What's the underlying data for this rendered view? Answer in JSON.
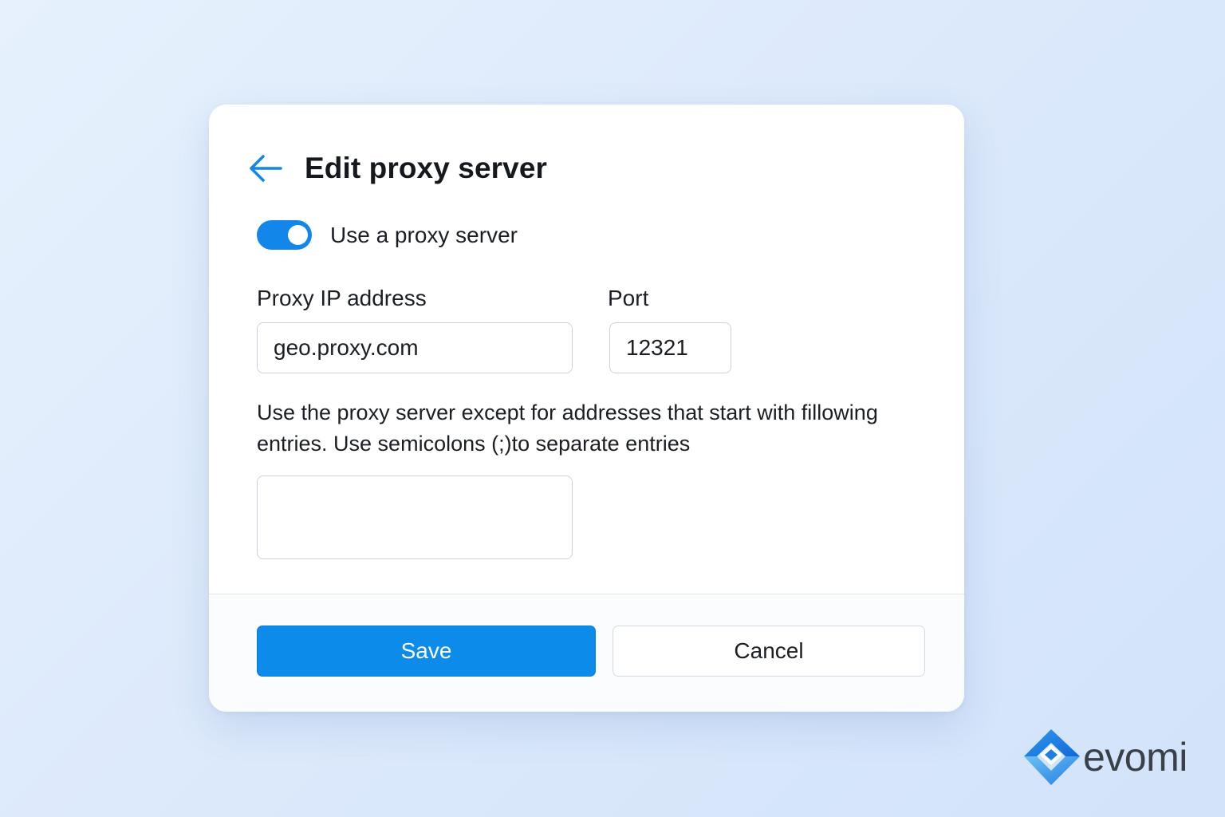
{
  "dialog": {
    "title": "Edit proxy server",
    "back_icon": "arrow-left-icon"
  },
  "proxy_toggle": {
    "label": "Use a proxy server",
    "enabled": true
  },
  "fields": {
    "ip_label": "Proxy IP address",
    "ip_value": "geo.proxy.com",
    "port_label": "Port",
    "port_value": "12321"
  },
  "exceptions": {
    "help_text": "Use the proxy server except for addresses that start with fillowing entries. Use semicolons (;)to separate entries",
    "value": ""
  },
  "footer": {
    "save_label": "Save",
    "cancel_label": "Cancel"
  },
  "branding": {
    "logo_text": "evomi"
  },
  "colors": {
    "accent": "#0c8bea",
    "background": "#dce9fb",
    "text": "#1b1f24"
  }
}
